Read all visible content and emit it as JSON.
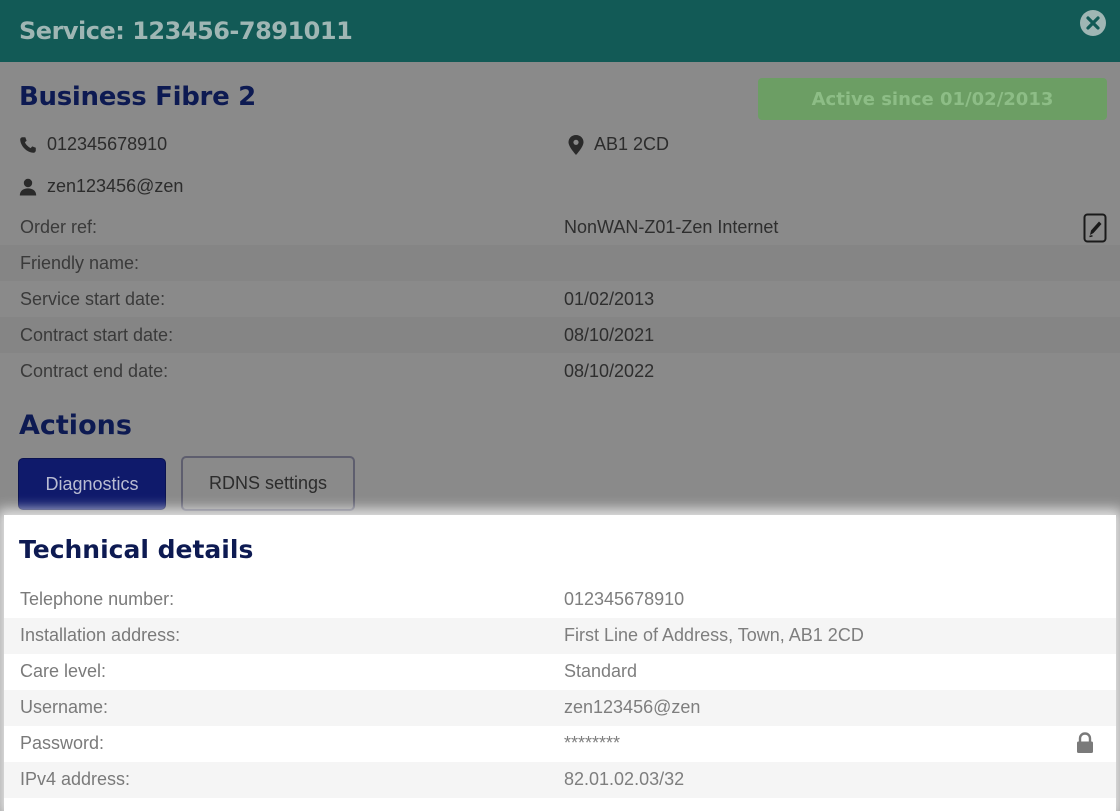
{
  "header": {
    "title": "Service: 123456-7891011",
    "close_icon": "close-circle-icon"
  },
  "service": {
    "product": "Business Fibre 2",
    "status": "Active since 01/02/2013",
    "phone": "012345678910",
    "postcode": "AB1 2CD",
    "username": "zen123456@zen"
  },
  "details": [
    {
      "label": "Order ref:",
      "value": "NonWAN-Z01-Zen Internet"
    },
    {
      "label": "Friendly name:",
      "value": ""
    },
    {
      "label": "Service start date:",
      "value": "01/02/2013"
    },
    {
      "label": "Contract start date:",
      "value": "08/10/2021"
    },
    {
      "label": "Contract end date:",
      "value": "08/10/2022"
    }
  ],
  "actions": {
    "title": "Actions",
    "diagnostics": "Diagnostics",
    "rdns": "RDNS settings"
  },
  "technical": {
    "title": "Technical details",
    "rows": [
      {
        "label": "Telephone number:",
        "value": "012345678910"
      },
      {
        "label": "Installation address:",
        "value": "First Line of Address, Town, AB1 2CD"
      },
      {
        "label": "Care level:",
        "value": "Standard"
      },
      {
        "label": "Username:",
        "value": "zen123456@zen"
      },
      {
        "label": "Password:",
        "value": "********"
      },
      {
        "label": "IPv4 address:",
        "value": "82.01.02.03/32"
      }
    ]
  },
  "colors": {
    "header": "#125a56",
    "brand_navy": "#0d1a52",
    "status_green": "#6c9e64",
    "primary_button": "#0f1a6b"
  }
}
